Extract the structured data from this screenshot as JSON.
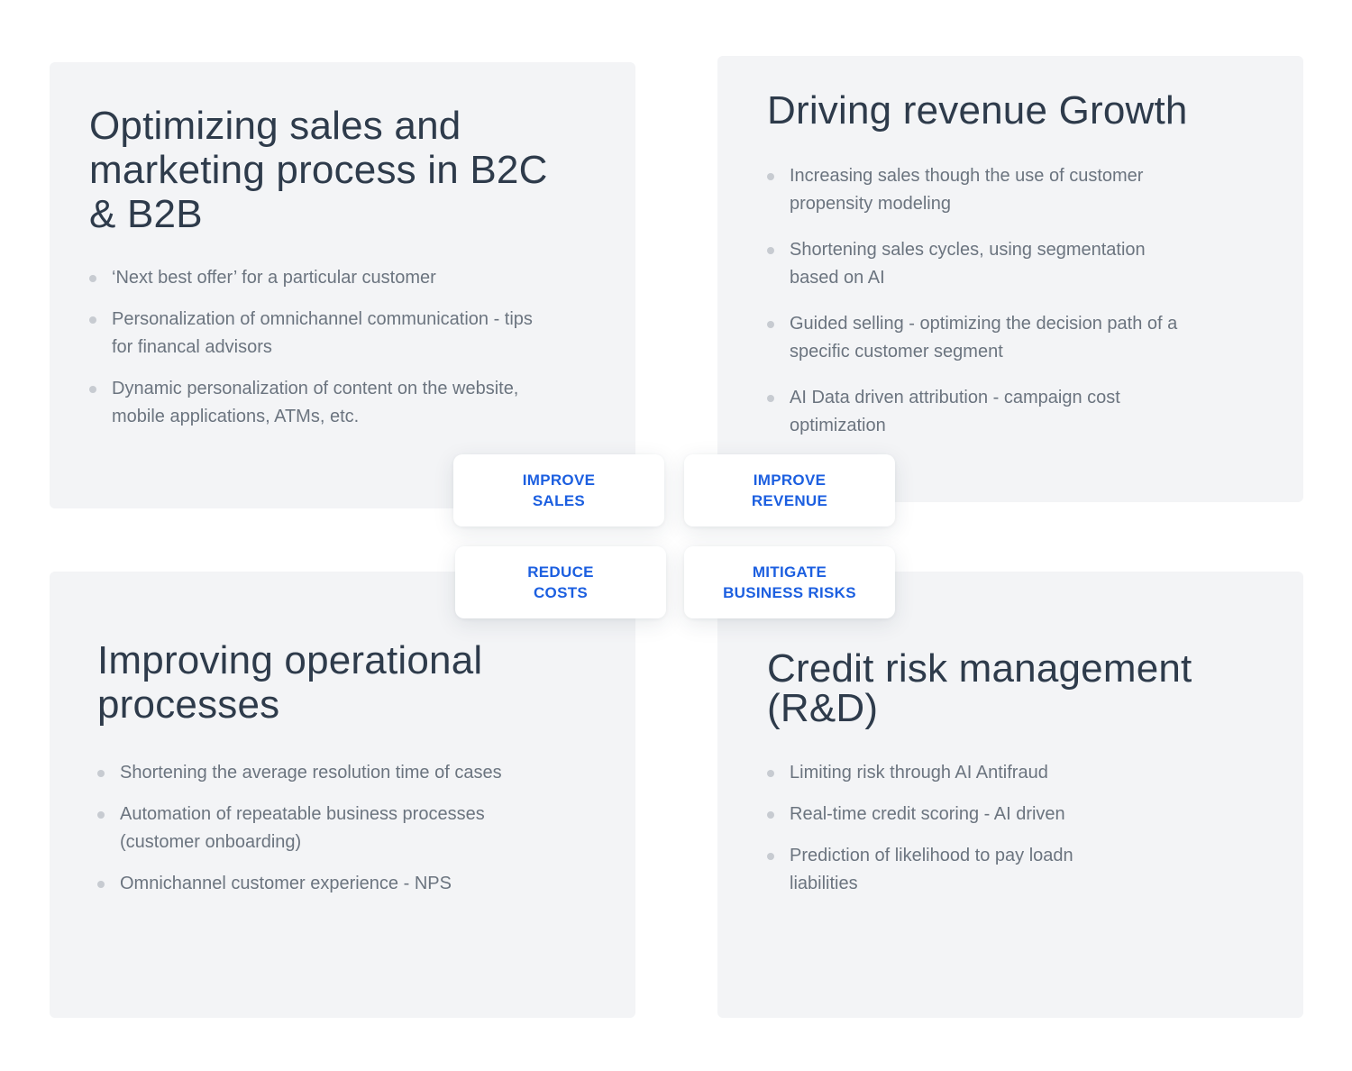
{
  "cards": {
    "top_left": {
      "title": "Optimizing sales and marketing process in B2C & B2B",
      "bullets": [
        "‘Next best offer’ for a particular customer",
        "Personalization of omnichannel communication - tips for financal advisors",
        "Dynamic personalization of content on the website, mobile applications, ATMs, etc."
      ]
    },
    "top_right": {
      "title": "Driving revenue Growth",
      "bullets": [
        "Increasing sales though the use of customer propensity modeling",
        "Shortening sales cycles, using segmentation based on AI",
        "Guided selling - optimizing the decision path of a specific customer segment",
        "AI Data driven attribution - campaign cost optimization"
      ]
    },
    "bottom_left": {
      "title": "Improving operational processes",
      "bullets": [
        "Shortening the average resolution time of cases",
        "Automation of repeatable business processes (customer onboarding)",
        "Omnichannel customer experience - NPS"
      ]
    },
    "bottom_right": {
      "title": "Credit risk management (R&D)",
      "bullets": [
        "Limiting risk through AI Antifraud",
        "Real-time credit scoring - AI driven",
        "Prediction of likelihood to pay loadn liabilities"
      ]
    }
  },
  "pills": {
    "improve_sales": "IMPROVE\nSALES",
    "improve_revenue": "IMPROVE\nREVENUE",
    "reduce_costs": "REDUCE\nCOSTS",
    "mitigate_risks": "MITIGATE\nBUSINESS RISKS"
  },
  "colors": {
    "card_background": "#f3f4f6",
    "title_text": "#2e3b4b",
    "bullet_text": "#6b747f",
    "bullet_dot": "#c7cbd1",
    "pill_text": "#1c5fe0"
  }
}
